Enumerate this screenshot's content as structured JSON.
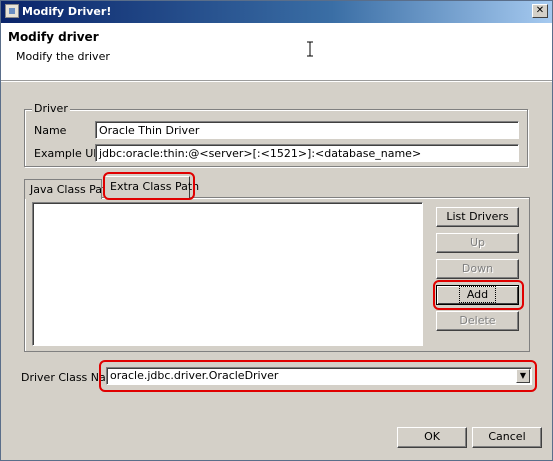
{
  "window": {
    "title": "Modify Driver!",
    "close_glyph": "✕"
  },
  "header": {
    "title": "Modify driver",
    "subtitle": "Modify the driver"
  },
  "driver_group": {
    "legend": "Driver",
    "name_label": "Name",
    "name_value": "Oracle Thin Driver",
    "url_label": "Example URL",
    "url_value": "jdbc:oracle:thin:@<server>[:<1521>]:<database_name>"
  },
  "tabs": [
    {
      "label": "Java Class Path",
      "selected": false
    },
    {
      "label": "Extra Class Path",
      "selected": true
    }
  ],
  "side_buttons": {
    "list_drivers": "List Drivers",
    "up": "Up",
    "down": "Down",
    "add": "Add",
    "delete": "Delete"
  },
  "driver_class": {
    "label": "Driver Class Name",
    "value": "oracle.jdbc.driver.OracleDriver",
    "arrow_glyph": "▼"
  },
  "footer": {
    "ok": "OK",
    "cancel": "Cancel"
  },
  "colors": {
    "highlight": "#e00000",
    "titlebar": "#0a246a",
    "dialog_bg": "#d4d0c8"
  }
}
